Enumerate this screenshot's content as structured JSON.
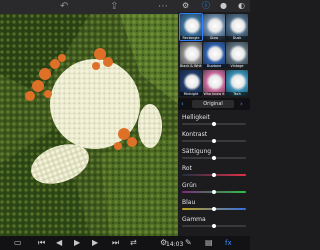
{
  "toolbar": {
    "undo_icon": "undo-icon",
    "share_icon": "share-icon",
    "more_icon": "more-icon"
  },
  "right_toolbar": {
    "icons": [
      "gear-icon",
      "info-icon",
      "drop-icon",
      "palette-icon"
    ]
  },
  "filters": [
    {
      "label": "Rectangle",
      "tint": "#3a6f9a"
    },
    {
      "label": "Glow",
      "tint": "#6d8aa8"
    },
    {
      "label": "Dusk",
      "tint": "#4d6a85"
    },
    {
      "label": "Black & White",
      "tint": "#8a8a8a"
    },
    {
      "label": "Duotone",
      "tint": "#2f5ea8"
    },
    {
      "label": "Vintage",
      "tint": "#5c6f7c"
    },
    {
      "label": "Midnight",
      "tint": "#1f3a66"
    },
    {
      "label": "Who know it",
      "tint": "#c86a9a"
    },
    {
      "label": "Tech",
      "tint": "#3a8fb4"
    }
  ],
  "preset": {
    "name": "Original",
    "colors": {
      "accent": "#2f7fff"
    }
  },
  "adjustments": [
    {
      "label": "Helligkeit",
      "value": 0.5,
      "gradient": "linear-gradient(90deg,#3a3a3c,#3a3a3c)"
    },
    {
      "label": "Kontrast",
      "value": 0.5,
      "gradient": "linear-gradient(90deg,#3a3a3c,#3a3a3c)"
    },
    {
      "label": "Sättigung",
      "value": 0.5,
      "gradient": "linear-gradient(90deg,#3a3a3c,#3a3a3c)"
    },
    {
      "label": "Rot",
      "value": 0.5,
      "gradient": "linear-gradient(90deg,#203040,#e0304a)"
    },
    {
      "label": "Grün",
      "value": 0.5,
      "gradient": "linear-gradient(90deg,#7a2a7a,#2ac04a)"
    },
    {
      "label": "Blau",
      "value": 0.5,
      "gradient": "linear-gradient(90deg,#c0a020,#3070e0)"
    },
    {
      "label": "Gamma",
      "value": 0.5,
      "gradient": "linear-gradient(90deg,#3a3a3c,#3a3a3c)"
    }
  ],
  "playback": {
    "time": "14:03",
    "icons": [
      "screen-icon",
      "skip-back-icon",
      "rewind-icon",
      "play-icon",
      "forward-icon",
      "skip-forward-icon",
      "swap-icon",
      "settings-icon",
      "edit-icon",
      "layers-icon",
      "fx-icon"
    ]
  }
}
